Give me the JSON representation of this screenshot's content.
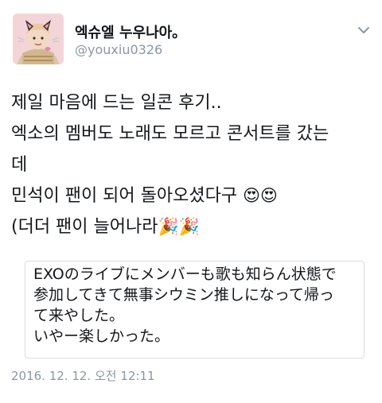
{
  "author": {
    "display_name": "엑슈엘 누우나아。",
    "handle": "@youxiu0326",
    "avatar_icon": "profile-photo-with-cat-ears-icon",
    "menu_icon": "chevron-down-icon"
  },
  "tweet": {
    "lines": [
      "제일 마음에 드는 일콘 후기..",
      "엑소의 멤버도 노래도 모르고 콘서트를 갔는",
      "데",
      "민석이 팬이 되어 돌아오셨다구",
      "(더더 팬이 늘어나라"
    ],
    "emoji_heart_eyes": "😍😍",
    "emoji_party": "🎉🎉",
    "quote_lines": [
      "EXOのライブにメンバーも歌も知らん状態で",
      "参加してきて無事シウミン推しになって帰っ",
      "て来やした。",
      "いやー楽しかった。"
    ],
    "timestamp": "2016. 12. 12. 오전 12:11"
  },
  "colors": {
    "text": "#14171a",
    "secondary_text": "#8a97a3",
    "border": "#d6dde3"
  }
}
